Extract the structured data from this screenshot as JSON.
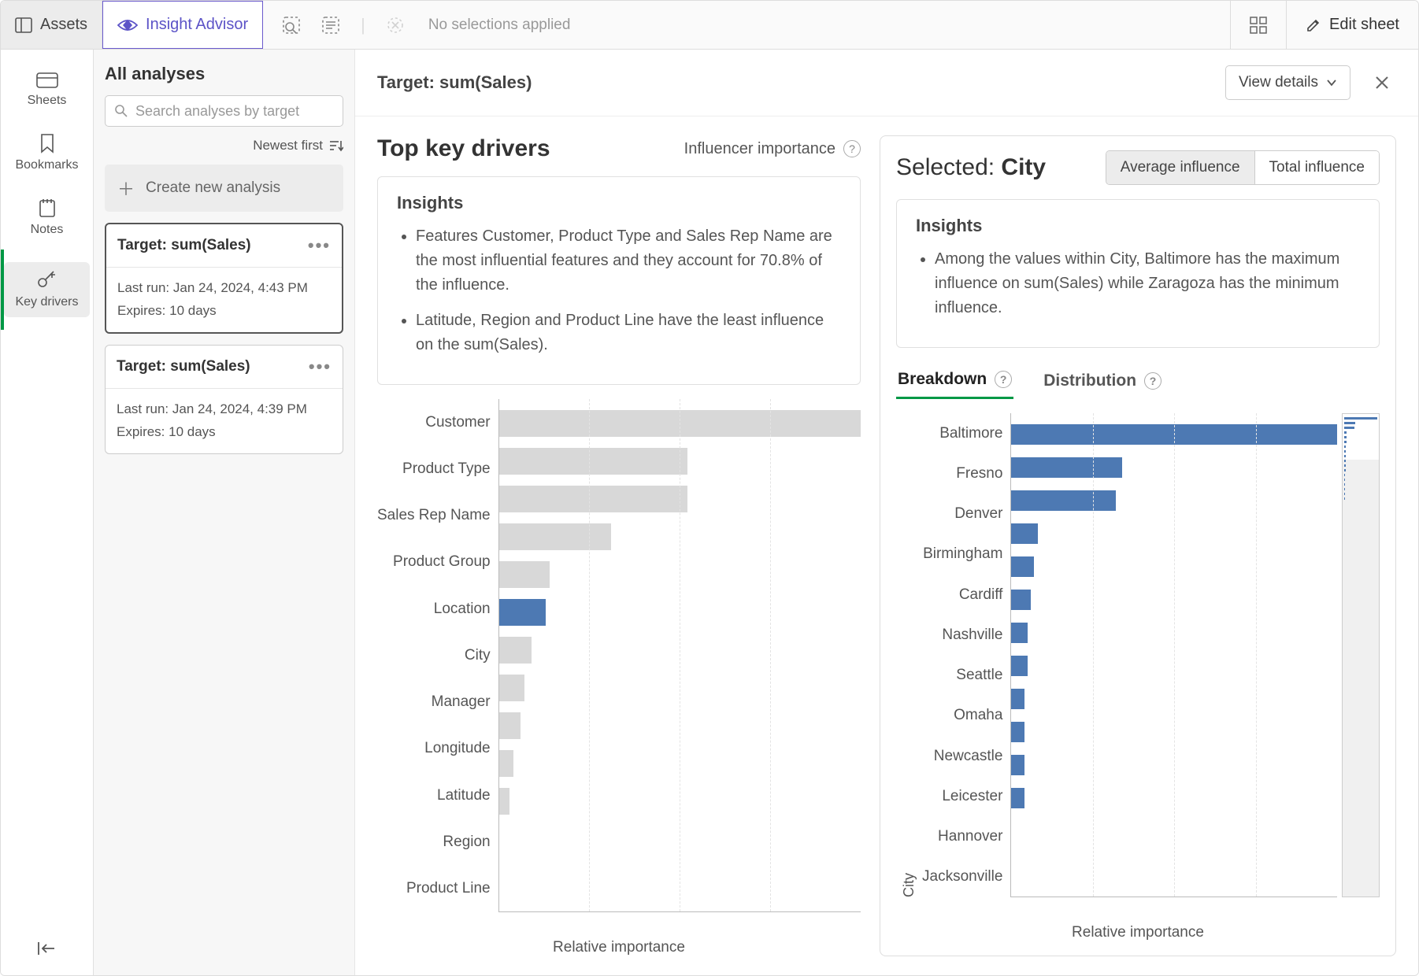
{
  "topbar": {
    "assets": "Assets",
    "insight": "Insight Advisor",
    "no_selections": "No selections applied",
    "edit_sheet": "Edit sheet"
  },
  "rail": {
    "sheets": "Sheets",
    "bookmarks": "Bookmarks",
    "notes": "Notes",
    "key_drivers": "Key drivers"
  },
  "analyses": {
    "title": "All analyses",
    "search_placeholder": "Search analyses by target",
    "sort_label": "Newest first",
    "create": "Create new analysis",
    "cards": [
      {
        "title": "Target: sum(Sales)",
        "last_run": "Last run: Jan 24, 2024, 4:43 PM",
        "expires": "Expires: 10 days"
      },
      {
        "title": "Target: sum(Sales)",
        "last_run": "Last run: Jan 24, 2024, 4:39 PM",
        "expires": "Expires: 10 days"
      }
    ]
  },
  "main": {
    "target_label": "Target: sum(Sales)",
    "view_details": "View details",
    "left": {
      "title": "Top key drivers",
      "subtitle": "Influencer importance",
      "insights_header": "Insights",
      "insights": [
        "Features Customer, Product Type and Sales Rep Name are the most influential features and they account for 70.8% of the influence.",
        "Latitude, Region and Product Line have the least influence on the sum(Sales)."
      ],
      "xlabel": "Relative importance"
    },
    "right": {
      "selected_prefix": "Selected: ",
      "selected_value": "City",
      "toggle_avg": "Average influence",
      "toggle_total": "Total influence",
      "insights_header": "Insights",
      "insights": [
        "Among the values within City, Baltimore has the maximum influence on sum(Sales) while Zaragoza has the minimum influence."
      ],
      "tab_breakdown": "Breakdown",
      "tab_distribution": "Distribution",
      "yaxis": "City",
      "xlabel": "Relative importance"
    }
  },
  "chart_data": [
    {
      "type": "bar",
      "orientation": "horizontal",
      "title": "Top key drivers",
      "xlabel": "Relative importance",
      "highlight": "City",
      "categories": [
        "Customer",
        "Product Type",
        "Sales Rep Name",
        "Product Group",
        "Location",
        "City",
        "Manager",
        "Longitude",
        "Latitude",
        "Region",
        "Product Line"
      ],
      "values": [
        100,
        52,
        52,
        31,
        14,
        13,
        9,
        7,
        6,
        4,
        3
      ],
      "xlim": [
        0,
        100
      ]
    },
    {
      "type": "bar",
      "orientation": "horizontal",
      "title": "Breakdown by City",
      "xlabel": "Relative importance",
      "ylabel": "City",
      "categories": [
        "Baltimore",
        "Fresno",
        "Denver",
        "Birmingham",
        "Cardiff",
        "Nashville",
        "Seattle",
        "Omaha",
        "Newcastle",
        "Leicester",
        "Hannover",
        "Jacksonville"
      ],
      "values": [
        100,
        34,
        32,
        8,
        7,
        6,
        5,
        5,
        4,
        4,
        4,
        4
      ],
      "xlim": [
        0,
        100
      ]
    }
  ]
}
